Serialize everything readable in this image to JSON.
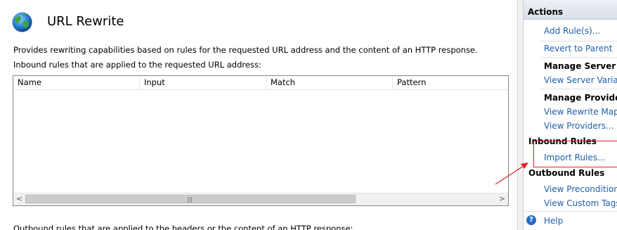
{
  "main": {
    "title": "URL Rewrite",
    "description": "Provides rewriting capabilities based on rules for the requested URL address and the content of an HTTP response.",
    "inbound_label": "Inbound rules that are applied to the requested URL address:",
    "columns": [
      "Name",
      "Input",
      "Match",
      "Pattern"
    ],
    "outbound_label": "Outbound rules that are applied to the headers or the content of an HTTP response:",
    "scroll_left": "<",
    "scroll_right": ">",
    "scroll_grip": "|||"
  },
  "actions": {
    "title": "Actions",
    "add_rules": "Add Rule(s)...",
    "revert": "Revert to Parent",
    "manage_server_vars": "Manage Server Var",
    "view_server_vars": "View Server Variable",
    "manage_providers": "Manage Providers",
    "view_rewrite_maps": "View Rewrite Maps...",
    "view_providers": "View Providers...",
    "inbound_rules": "Inbound Rules",
    "import_rules": "Import Rules...",
    "outbound_rules": "Outbound Rules",
    "view_preconditions": "View Preconditions...",
    "view_custom_tags": "View Custom Tags...",
    "help": "Help"
  },
  "colors": {
    "link": "#1f5ea8",
    "highlight": "#e8202a"
  }
}
